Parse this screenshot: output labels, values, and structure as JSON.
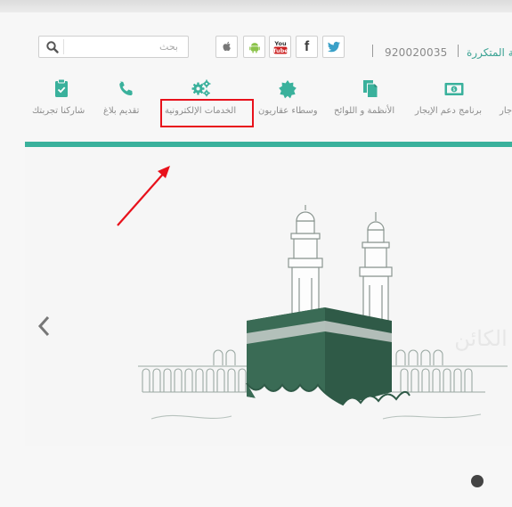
{
  "header": {
    "search_placeholder": "بحث",
    "phone": "920020035",
    "faq_link": "الأسئلة المتكررة",
    "social": [
      "twitter-icon",
      "facebook-icon",
      "youtube-icon",
      "android-icon",
      "apple-icon"
    ],
    "youtube_label": "You Tube",
    "facebook_label": "f"
  },
  "nav": {
    "items": [
      {
        "label": "شاركنا تجربتك",
        "icon": "clipboard-check-icon"
      },
      {
        "label": "تقديم بلاغ",
        "icon": "phone-icon"
      },
      {
        "label": "الخدمات الإلكترونية",
        "icon": "gears-icon"
      },
      {
        "label": "وسطاء عقاريون",
        "icon": "badge-icon"
      },
      {
        "label": "الأنظمة و اللوائح",
        "icon": "documents-icon"
      },
      {
        "label": "برنامج دعم الإيجار",
        "icon": "money-icon"
      },
      {
        "label": "جار",
        "icon": ""
      }
    ],
    "highlighted_item": "الخدمات الإلكترونية"
  },
  "banner": {
    "watermark": "الكائن",
    "slides": 1
  },
  "colors": {
    "accent": "#3ab19c",
    "highlight": "#e8111b",
    "kaaba": "#2f5a47"
  }
}
